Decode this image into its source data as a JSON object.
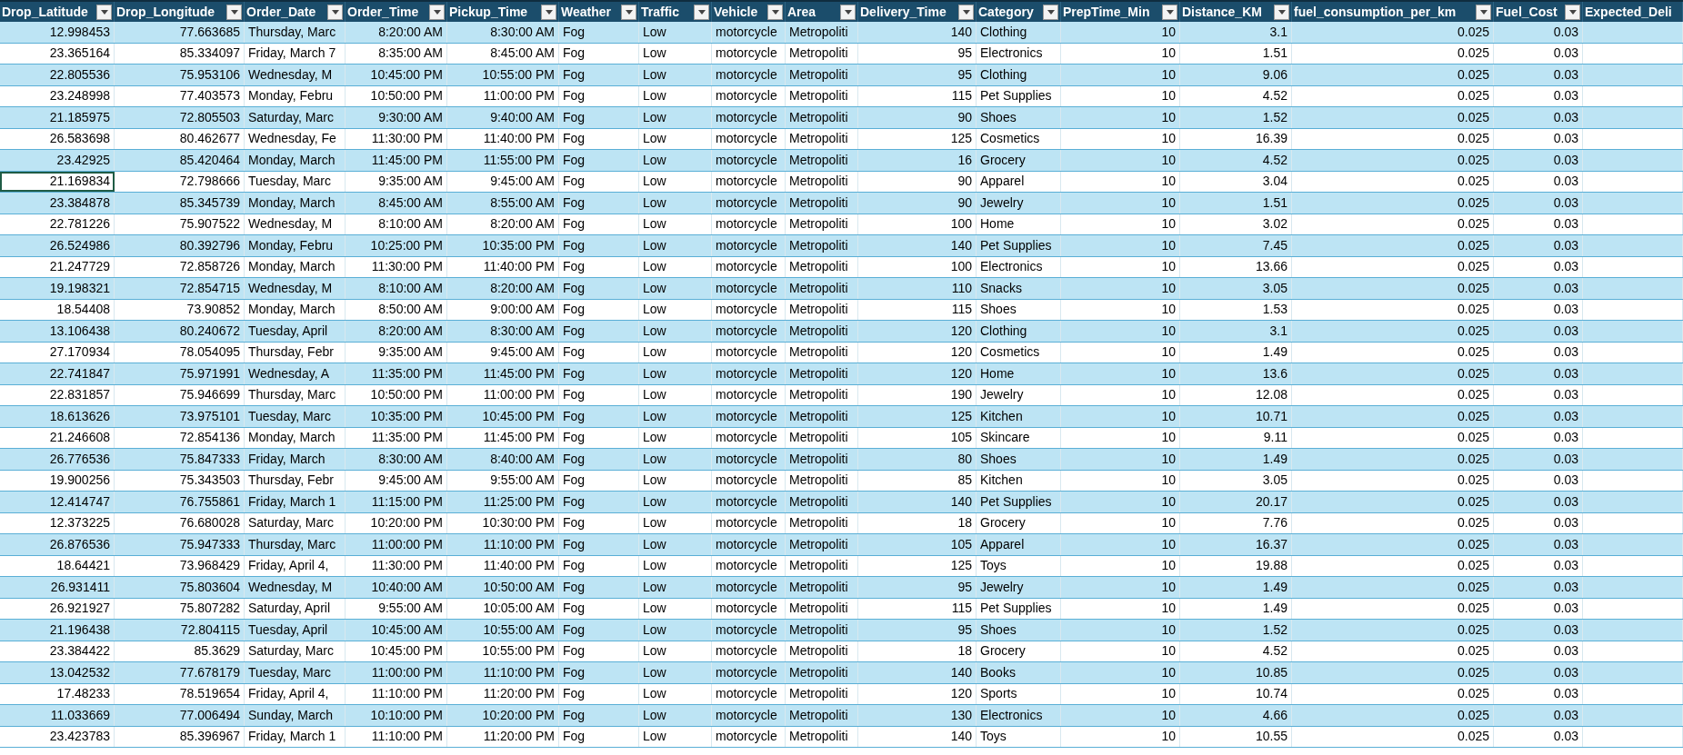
{
  "columns": [
    {
      "label": "Drop_Latitude",
      "kind": "number",
      "filter": true
    },
    {
      "label": "Drop_Longitude",
      "kind": "number",
      "filter": true
    },
    {
      "label": "Order_Date",
      "kind": "text",
      "filter": true
    },
    {
      "label": "Order_Time",
      "kind": "number",
      "filter": true
    },
    {
      "label": "Pickup_Time",
      "kind": "number",
      "filter": true
    },
    {
      "label": "Weather",
      "kind": "text",
      "filter": true
    },
    {
      "label": "Traffic",
      "kind": "text",
      "filter": true
    },
    {
      "label": "Vehicle",
      "kind": "text",
      "filter": true
    },
    {
      "label": "Area",
      "kind": "text",
      "filter": true
    },
    {
      "label": "Delivery_Time",
      "kind": "number",
      "filter": true
    },
    {
      "label": "Category",
      "kind": "text",
      "filter": true
    },
    {
      "label": "PrepTime_Min",
      "kind": "number",
      "filter": true
    },
    {
      "label": "Distance_KM",
      "kind": "number",
      "filter": true
    },
    {
      "label": "fuel_consumption_per_km",
      "kind": "number",
      "filter": true
    },
    {
      "label": "Fuel_Cost",
      "kind": "number",
      "filter": true
    },
    {
      "label": "Expected_Deli",
      "kind": "text",
      "filter": false
    }
  ],
  "rows": [
    {
      "selected": false,
      "cells": [
        "12.998453",
        "77.663685",
        "Thursday, Marc",
        "8:20:00 AM",
        "8:30:00 AM",
        "Fog",
        "Low",
        "motorcycle",
        "Metropoliti",
        "140",
        "Clothing",
        "10",
        "3.1",
        "0.025",
        "0.03"
      ]
    },
    {
      "selected": false,
      "cells": [
        "23.365164",
        "85.334097",
        "Friday, March 7",
        "8:35:00 AM",
        "8:45:00 AM",
        "Fog",
        "Low",
        "motorcycle",
        "Metropoliti",
        "95",
        "Electronics",
        "10",
        "1.51",
        "0.025",
        "0.03"
      ]
    },
    {
      "selected": false,
      "cells": [
        "22.805536",
        "75.953106",
        "Wednesday, M",
        "10:45:00 PM",
        "10:55:00 PM",
        "Fog",
        "Low",
        "motorcycle",
        "Metropoliti",
        "95",
        "Clothing",
        "10",
        "9.06",
        "0.025",
        "0.03"
      ]
    },
    {
      "selected": false,
      "cells": [
        "23.248998",
        "77.403573",
        "Monday, Febru",
        "10:50:00 PM",
        "11:00:00 PM",
        "Fog",
        "Low",
        "motorcycle",
        "Metropoliti",
        "115",
        "Pet Supplies",
        "10",
        "4.52",
        "0.025",
        "0.03"
      ]
    },
    {
      "selected": false,
      "cells": [
        "21.185975",
        "72.805503",
        "Saturday, Marc",
        "9:30:00 AM",
        "9:40:00 AM",
        "Fog",
        "Low",
        "motorcycle",
        "Metropoliti",
        "90",
        "Shoes",
        "10",
        "1.52",
        "0.025",
        "0.03"
      ]
    },
    {
      "selected": false,
      "cells": [
        "26.583698",
        "80.462677",
        "Wednesday, Fe",
        "11:30:00 PM",
        "11:40:00 PM",
        "Fog",
        "Low",
        "motorcycle",
        "Metropoliti",
        "125",
        "Cosmetics",
        "10",
        "16.39",
        "0.025",
        "0.03"
      ]
    },
    {
      "selected": false,
      "cells": [
        "23.42925",
        "85.420464",
        "Monday, March",
        "11:45:00 PM",
        "11:55:00 PM",
        "Fog",
        "Low",
        "motorcycle",
        "Metropoliti",
        "16",
        "Grocery",
        "10",
        "4.52",
        "0.025",
        "0.03"
      ]
    },
    {
      "selected": true,
      "cells": [
        "21.169834",
        "72.798666",
        "Tuesday, Marc",
        "9:35:00 AM",
        "9:45:00 AM",
        "Fog",
        "Low",
        "motorcycle",
        "Metropoliti",
        "90",
        "Apparel",
        "10",
        "3.04",
        "0.025",
        "0.03"
      ]
    },
    {
      "selected": false,
      "cells": [
        "23.384878",
        "85.345739",
        "Monday, March",
        "8:45:00 AM",
        "8:55:00 AM",
        "Fog",
        "Low",
        "motorcycle",
        "Metropoliti",
        "90",
        "Jewelry",
        "10",
        "1.51",
        "0.025",
        "0.03"
      ]
    },
    {
      "selected": false,
      "cells": [
        "22.781226",
        "75.907522",
        "Wednesday, M",
        "8:10:00 AM",
        "8:20:00 AM",
        "Fog",
        "Low",
        "motorcycle",
        "Metropoliti",
        "100",
        "Home",
        "10",
        "3.02",
        "0.025",
        "0.03"
      ]
    },
    {
      "selected": false,
      "cells": [
        "26.524986",
        "80.392796",
        "Monday, Febru",
        "10:25:00 PM",
        "10:35:00 PM",
        "Fog",
        "Low",
        "motorcycle",
        "Metropoliti",
        "140",
        "Pet Supplies",
        "10",
        "7.45",
        "0.025",
        "0.03"
      ]
    },
    {
      "selected": false,
      "cells": [
        "21.247729",
        "72.858726",
        "Monday, March",
        "11:30:00 PM",
        "11:40:00 PM",
        "Fog",
        "Low",
        "motorcycle",
        "Metropoliti",
        "100",
        "Electronics",
        "10",
        "13.66",
        "0.025",
        "0.03"
      ]
    },
    {
      "selected": false,
      "cells": [
        "19.198321",
        "72.854715",
        "Wednesday, M",
        "8:10:00 AM",
        "8:20:00 AM",
        "Fog",
        "Low",
        "motorcycle",
        "Metropoliti",
        "110",
        "Snacks",
        "10",
        "3.05",
        "0.025",
        "0.03"
      ]
    },
    {
      "selected": false,
      "cells": [
        "18.54408",
        "73.90852",
        "Monday, March",
        "8:50:00 AM",
        "9:00:00 AM",
        "Fog",
        "Low",
        "motorcycle",
        "Metropoliti",
        "115",
        "Shoes",
        "10",
        "1.53",
        "0.025",
        "0.03"
      ]
    },
    {
      "selected": false,
      "cells": [
        "13.106438",
        "80.240672",
        "Tuesday, April",
        "8:20:00 AM",
        "8:30:00 AM",
        "Fog",
        "Low",
        "motorcycle",
        "Metropoliti",
        "120",
        "Clothing",
        "10",
        "3.1",
        "0.025",
        "0.03"
      ]
    },
    {
      "selected": false,
      "cells": [
        "27.170934",
        "78.054095",
        "Thursday, Febr",
        "9:35:00 AM",
        "9:45:00 AM",
        "Fog",
        "Low",
        "motorcycle",
        "Metropoliti",
        "120",
        "Cosmetics",
        "10",
        "1.49",
        "0.025",
        "0.03"
      ]
    },
    {
      "selected": false,
      "cells": [
        "22.741847",
        "75.971991",
        "Wednesday, A",
        "11:35:00 PM",
        "11:45:00 PM",
        "Fog",
        "Low",
        "motorcycle",
        "Metropoliti",
        "120",
        "Home",
        "10",
        "13.6",
        "0.025",
        "0.03"
      ]
    },
    {
      "selected": false,
      "cells": [
        "22.831857",
        "75.946699",
        "Thursday, Marc",
        "10:50:00 PM",
        "11:00:00 PM",
        "Fog",
        "Low",
        "motorcycle",
        "Metropoliti",
        "190",
        "Jewelry",
        "10",
        "12.08",
        "0.025",
        "0.03"
      ]
    },
    {
      "selected": false,
      "cells": [
        "18.613626",
        "73.975101",
        "Tuesday, Marc",
        "10:35:00 PM",
        "10:45:00 PM",
        "Fog",
        "Low",
        "motorcycle",
        "Metropoliti",
        "125",
        "Kitchen",
        "10",
        "10.71",
        "0.025",
        "0.03"
      ]
    },
    {
      "selected": false,
      "cells": [
        "21.246608",
        "72.854136",
        "Monday, March",
        "11:35:00 PM",
        "11:45:00 PM",
        "Fog",
        "Low",
        "motorcycle",
        "Metropoliti",
        "105",
        "Skincare",
        "10",
        "9.11",
        "0.025",
        "0.03"
      ]
    },
    {
      "selected": false,
      "cells": [
        "26.776536",
        "75.847333",
        "Friday, March",
        "8:30:00 AM",
        "8:40:00 AM",
        "Fog",
        "Low",
        "motorcycle",
        "Metropoliti",
        "80",
        "Shoes",
        "10",
        "1.49",
        "0.025",
        "0.03"
      ]
    },
    {
      "selected": false,
      "cells": [
        "19.900256",
        "75.343503",
        "Thursday, Febr",
        "9:45:00 AM",
        "9:55:00 AM",
        "Fog",
        "Low",
        "motorcycle",
        "Metropoliti",
        "85",
        "Kitchen",
        "10",
        "3.05",
        "0.025",
        "0.03"
      ]
    },
    {
      "selected": false,
      "cells": [
        "12.414747",
        "76.755861",
        "Friday, March 1",
        "11:15:00 PM",
        "11:25:00 PM",
        "Fog",
        "Low",
        "motorcycle",
        "Metropoliti",
        "140",
        "Pet Supplies",
        "10",
        "20.17",
        "0.025",
        "0.03"
      ]
    },
    {
      "selected": false,
      "cells": [
        "12.373225",
        "76.680028",
        "Saturday, Marc",
        "10:20:00 PM",
        "10:30:00 PM",
        "Fog",
        "Low",
        "motorcycle",
        "Metropoliti",
        "18",
        "Grocery",
        "10",
        "7.76",
        "0.025",
        "0.03"
      ]
    },
    {
      "selected": false,
      "cells": [
        "26.876536",
        "75.947333",
        "Thursday, Marc",
        "11:00:00 PM",
        "11:10:00 PM",
        "Fog",
        "Low",
        "motorcycle",
        "Metropoliti",
        "105",
        "Apparel",
        "10",
        "16.37",
        "0.025",
        "0.03"
      ]
    },
    {
      "selected": false,
      "cells": [
        "18.64421",
        "73.968429",
        "Friday, April 4,",
        "11:30:00 PM",
        "11:40:00 PM",
        "Fog",
        "Low",
        "motorcycle",
        "Metropoliti",
        "125",
        "Toys",
        "10",
        "19.88",
        "0.025",
        "0.03"
      ]
    },
    {
      "selected": false,
      "cells": [
        "26.931411",
        "75.803604",
        "Wednesday, M",
        "10:40:00 AM",
        "10:50:00 AM",
        "Fog",
        "Low",
        "motorcycle",
        "Metropoliti",
        "95",
        "Jewelry",
        "10",
        "1.49",
        "0.025",
        "0.03"
      ]
    },
    {
      "selected": false,
      "cells": [
        "26.921927",
        "75.807282",
        "Saturday, April",
        "9:55:00 AM",
        "10:05:00 AM",
        "Fog",
        "Low",
        "motorcycle",
        "Metropoliti",
        "115",
        "Pet Supplies",
        "10",
        "1.49",
        "0.025",
        "0.03"
      ]
    },
    {
      "selected": false,
      "cells": [
        "21.196438",
        "72.804115",
        "Tuesday, April",
        "10:45:00 AM",
        "10:55:00 AM",
        "Fog",
        "Low",
        "motorcycle",
        "Metropoliti",
        "95",
        "Shoes",
        "10",
        "1.52",
        "0.025",
        "0.03"
      ]
    },
    {
      "selected": false,
      "cells": [
        "23.384422",
        "85.3629",
        "Saturday, Marc",
        "10:45:00 PM",
        "10:55:00 PM",
        "Fog",
        "Low",
        "motorcycle",
        "Metropoliti",
        "18",
        "Grocery",
        "10",
        "4.52",
        "0.025",
        "0.03"
      ]
    },
    {
      "selected": false,
      "cells": [
        "13.042532",
        "77.678179",
        "Tuesday, Marc",
        "11:00:00 PM",
        "11:10:00 PM",
        "Fog",
        "Low",
        "motorcycle",
        "Metropoliti",
        "140",
        "Books",
        "10",
        "10.85",
        "0.025",
        "0.03"
      ]
    },
    {
      "selected": false,
      "cells": [
        "17.48233",
        "78.519654",
        "Friday, April 4,",
        "11:10:00 PM",
        "11:20:00 PM",
        "Fog",
        "Low",
        "motorcycle",
        "Metropoliti",
        "120",
        "Sports",
        "10",
        "10.74",
        "0.025",
        "0.03"
      ]
    },
    {
      "selected": false,
      "cells": [
        "11.033669",
        "77.006494",
        "Sunday, March",
        "10:10:00 PM",
        "10:20:00 PM",
        "Fog",
        "Low",
        "motorcycle",
        "Metropoliti",
        "130",
        "Electronics",
        "10",
        "4.66",
        "0.025",
        "0.03"
      ]
    },
    {
      "selected": false,
      "cells": [
        "23.423783",
        "85.396967",
        "Friday, March 1",
        "11:10:00 PM",
        "11:20:00 PM",
        "Fog",
        "Low",
        "motorcycle",
        "Metropoliti",
        "140",
        "Toys",
        "10",
        "10.55",
        "0.025",
        "0.03"
      ]
    }
  ]
}
